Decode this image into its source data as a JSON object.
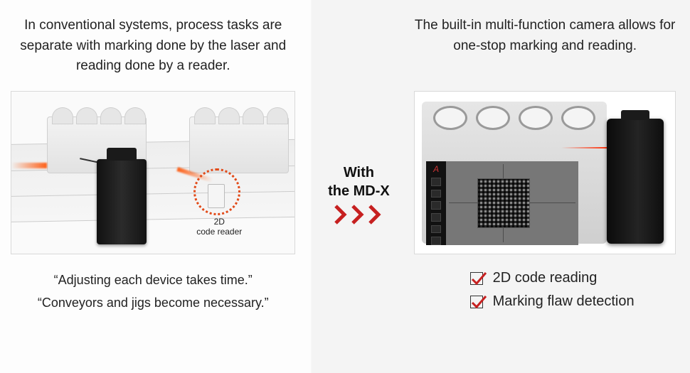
{
  "left": {
    "heading": "In conventional systems, process tasks are separate with marking done by the laser and reading done by a reader.",
    "reader_label_line1": "2D",
    "reader_label_line2": "code reader",
    "quote1": "“Adjusting each device takes time.”",
    "quote2": "“Conveyors and jigs become necessary.”"
  },
  "mid": {
    "line1": "With",
    "line2": "the MD-X"
  },
  "right": {
    "heading": "The built-in multi-function camera allows for one-stop marking and reading.",
    "benefit1": "2D code reading",
    "benefit2": "Marking flaw detection"
  },
  "colors": {
    "accent_red": "#c62020",
    "accent_orange": "#e24a18"
  }
}
